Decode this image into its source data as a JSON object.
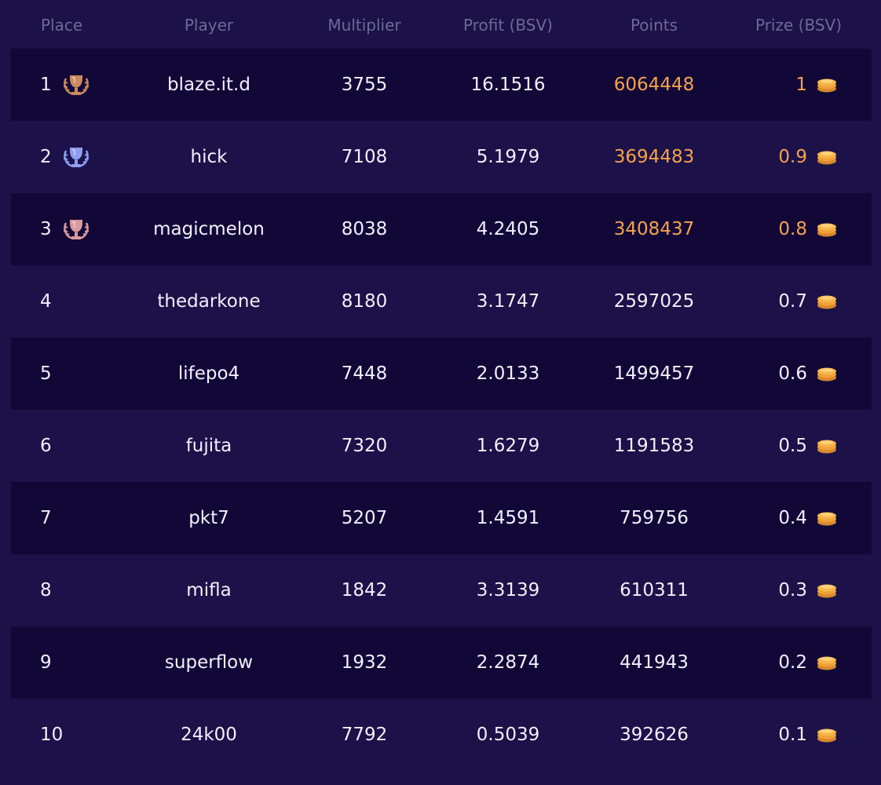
{
  "columns": {
    "place": "Place",
    "player": "Player",
    "multiplier": "Multiplier",
    "profit": "Profit (BSV)",
    "points": "Points",
    "prize": "Prize (BSV)"
  },
  "colors": {
    "background": "#1c1148",
    "row_dark": "#120838",
    "header_text": "#6c6a98",
    "text": "#f2f0fb",
    "highlight": "#f6a24a",
    "gold_trophy": "#c98a5e",
    "silver_trophy": "#8f9ef0",
    "bronze_trophy": "#d99a9e"
  },
  "rows": [
    {
      "place": "1",
      "player": "blaze.it.d",
      "multiplier": "3755",
      "profit": "16.1516",
      "points": "6064448",
      "prize": "1",
      "trophy": "gold-trophy-icon"
    },
    {
      "place": "2",
      "player": "hick",
      "multiplier": "7108",
      "profit": "5.1979",
      "points": "3694483",
      "prize": "0.9",
      "trophy": "silver-trophy-icon"
    },
    {
      "place": "3",
      "player": "magicmelon",
      "multiplier": "8038",
      "profit": "4.2405",
      "points": "3408437",
      "prize": "0.8",
      "trophy": "bronze-trophy-icon"
    },
    {
      "place": "4",
      "player": "thedarkone",
      "multiplier": "8180",
      "profit": "3.1747",
      "points": "2597025",
      "prize": "0.7"
    },
    {
      "place": "5",
      "player": "lifepo4",
      "multiplier": "7448",
      "profit": "2.0133",
      "points": "1499457",
      "prize": "0.6"
    },
    {
      "place": "6",
      "player": "fujita",
      "multiplier": "7320",
      "profit": "1.6279",
      "points": "1191583",
      "prize": "0.5"
    },
    {
      "place": "7",
      "player": "pkt7",
      "multiplier": "5207",
      "profit": "1.4591",
      "points": "759756",
      "prize": "0.4"
    },
    {
      "place": "8",
      "player": "mifla",
      "multiplier": "1842",
      "profit": "3.3139",
      "points": "610311",
      "prize": "0.3"
    },
    {
      "place": "9",
      "player": "superflow",
      "multiplier": "1932",
      "profit": "2.2874",
      "points": "441943",
      "prize": "0.2"
    },
    {
      "place": "10",
      "player": "24k00",
      "multiplier": "7792",
      "profit": "0.5039",
      "points": "392626",
      "prize": "0.1"
    }
  ]
}
